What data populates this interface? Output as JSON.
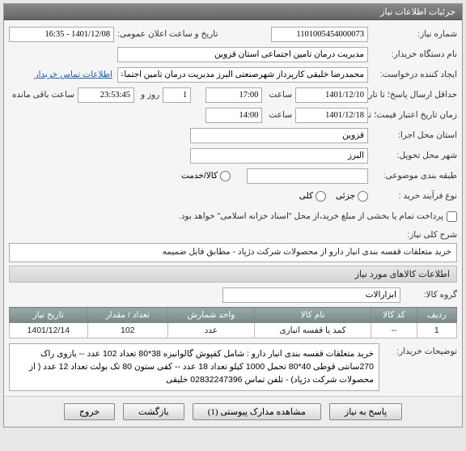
{
  "panel_title": "جزئیات اطلاعات نیاز",
  "labels": {
    "need_number": "شماره نیاز:",
    "announce_datetime": "تاریخ و ساعت اعلان عمومی:",
    "buyer_device": "نام دستگاه خریدار:",
    "requester": "ایجاد کننده درخواست:",
    "contact_info": "اطلاعات تماس خریدار",
    "deadline_send": "حداقل ارسال پاسخ؛ تا تاریخ:",
    "time_label": "ساعت",
    "day_and": "روز و",
    "remaining": "ساعت باقی مانده",
    "validity_until": "زمان تاریخ اعتبار قیمت؛ تا تاریخ:",
    "province_exec": "استان محل اجرا:",
    "city_delivery": "شهر محل تحویل:",
    "packaging": "طبقه بندی موضوعی:",
    "service": "کالا/خدمت",
    "purchase_type": "نوع فرآیند خرید :",
    "partial": "جزئی",
    "full": "کلی",
    "payment_note": "پرداخت تمام یا بخشی از مبلغ خرید،از محل \"اسناد خزانه اسلامی\" خواهد بود.",
    "need_desc_title": "شرح کلی نیاز:",
    "goods_info_title": "اطلاعات کالاهای مورد نیاز",
    "goods_group": "گروه کالا:",
    "buyer_notes": "توضیحات خریدار:"
  },
  "values": {
    "need_number": "1101005454000073",
    "announce_datetime": "1401/12/08 - 16:35",
    "buyer_device": "مدیریت درمان تامین اجتماعی استان قزوین",
    "requester": "محمدرضا خلیقی کارپرداز شهرصنعتی البرز مدیریت درمان تامین اجتماعی استان ق",
    "deadline_date": "1401/12/10",
    "deadline_time": "17:00",
    "days_remaining": "1",
    "time_remaining": "23:53:45",
    "validity_date": "1401/12/18",
    "validity_time": "14:00",
    "province": "قزوین",
    "city": "البرز",
    "packaging": "",
    "goods_group": "ابزارآلات",
    "need_desc": "خرید متعلقات قفسه بندی انبار دارو  از محصولات شرکت دژپاد - مطابق فایل ضمیمه",
    "buyer_notes": "خرید متعلقات قفسه بندی انبار دارو  :  شامل کفپوش گالوانیزه 38*80 تعداد 102 عدد -- بازوی راک 270سانتی قوطی 40*80 تحمل 1000 کیلو تعداد 18 عدد -- کفی ستون 80 تک بولت تعداد 12 عدد ( از محصولات شرکت دژپاد) - تلفن تماس 02832247396 خلیقی"
  },
  "table": {
    "headers": {
      "row": "ردیف",
      "code": "کد کالا",
      "name": "نام کالا",
      "unit": "واحد شمارش",
      "qty": "تعداد / مقدار",
      "date": "تاریخ نیاز"
    },
    "rows": [
      {
        "row": "1",
        "code": "--",
        "name": "کمد یا قفسه انباری",
        "unit": "عدد",
        "qty": "102",
        "date": "1401/12/14"
      }
    ]
  },
  "buttons": {
    "respond": "پاسخ به نیاز",
    "attachments": "مشاهده مدارک پیوستی (1)",
    "back": "بازگشت",
    "exit": "خروج"
  }
}
